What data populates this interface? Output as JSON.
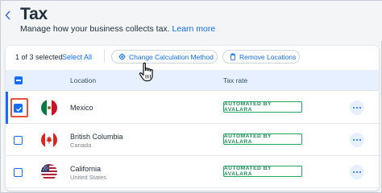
{
  "header": {
    "back_icon": "chevron-left-icon",
    "title": "Tax",
    "subtitle": "Manage how your business collects tax.",
    "learn_more": "Learn more"
  },
  "toolbar": {
    "selected_count": "1 of 3 selected",
    "select_all": "Select All",
    "change_method_label": "Change Calculation Method",
    "change_method_icon": "gear-icon",
    "remove_label": "Remove Locations",
    "remove_icon": "trash-icon"
  },
  "table": {
    "columns": {
      "location": "Location",
      "tax_rate": "Tax rate"
    },
    "rows": [
      {
        "name": "Mexico",
        "subtitle": "",
        "flag": "mexico-flag-icon",
        "checked": true,
        "badge": "AUTOMATED BY AVALARA"
      },
      {
        "name": "British Columbia",
        "subtitle": "Canada",
        "flag": "canada-flag-icon",
        "checked": false,
        "badge": "AUTOMATED BY AVALARA"
      },
      {
        "name": "California",
        "subtitle": "United States",
        "flag": "usa-flag-icon",
        "checked": false,
        "badge": "AUTOMATED BY AVALARA"
      }
    ]
  },
  "colors": {
    "accent": "#116dff",
    "badge_green": "#23a862",
    "highlight_red": "#e8523a",
    "header_row_bg": "#e7f0ff"
  }
}
